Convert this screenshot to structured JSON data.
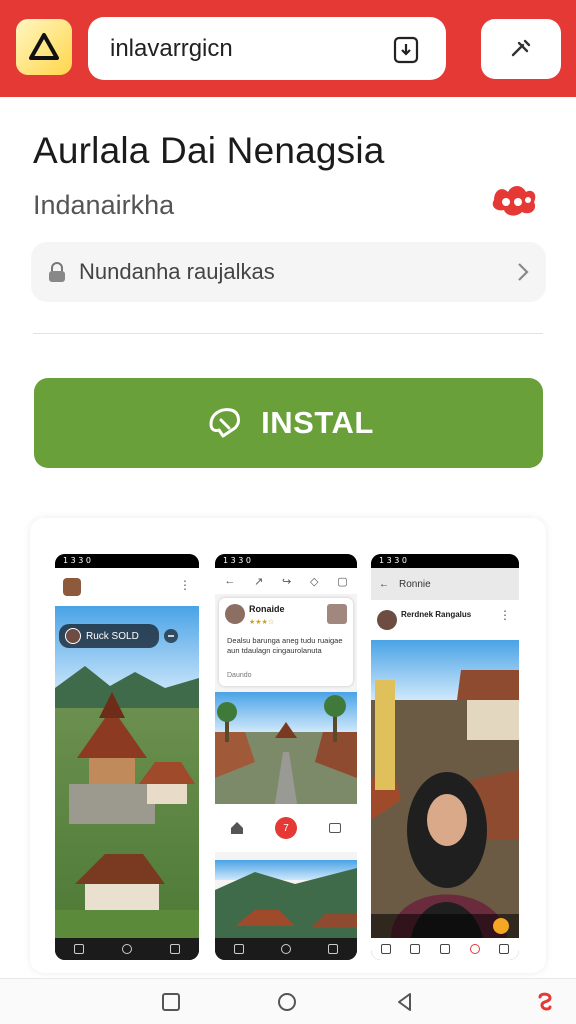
{
  "browser": {
    "url": "inlavarrgicn"
  },
  "app": {
    "title": "Aurlala Dai Nenagsia",
    "subtitle": "Indanairkha",
    "info_text": "Nundanha raujalkas",
    "install_label": "INSTAL"
  },
  "screens": [
    {
      "status": "1 3 3 0",
      "chip_text": "Ruck  SOLD"
    },
    {
      "status": "1 3 3 0",
      "post_name": "Ronaide",
      "post_caption": "Dealsu barunga aneg tudu ruaigae aun tdaulagn cingaurolanuta",
      "post_more": "Daundo",
      "nav_center": "7"
    },
    {
      "status": "1 3 3 0",
      "header_title": "Ronnie",
      "post_name": "Rerdnek Rangalus"
    }
  ],
  "colors": {
    "topbar": "#e53935",
    "install": "#6aa039"
  }
}
